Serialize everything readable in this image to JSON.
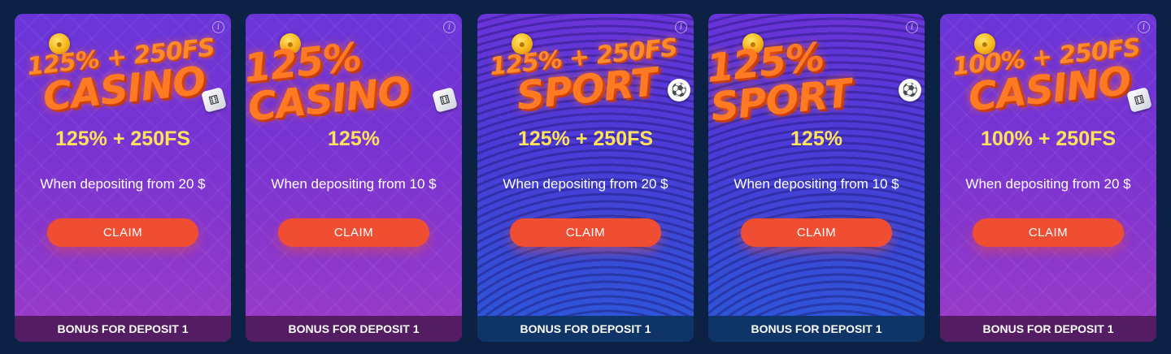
{
  "cards": [
    {
      "theme": "casino",
      "banner_line1": "125% + 250FS",
      "banner_line2": "CASINO",
      "amount": "125% + 250FS",
      "condition": "When depositing from 20 $",
      "claim_label": "CLAIM",
      "footer": "BONUS FOR DEPOSIT 1"
    },
    {
      "theme": "casino",
      "banner_line1": "",
      "banner_line2": "125% CASINO",
      "amount": "125%",
      "condition": "When depositing from 10 $",
      "claim_label": "CLAIM",
      "footer": "BONUS FOR DEPOSIT 1"
    },
    {
      "theme": "sport",
      "banner_line1": "125% + 250FS",
      "banner_line2": "SPORT",
      "amount": "125% + 250FS",
      "condition": "When depositing from 20 $",
      "claim_label": "CLAIM",
      "footer": "BONUS FOR DEPOSIT 1"
    },
    {
      "theme": "sport",
      "banner_line1": "",
      "banner_line2": "125% SPORT",
      "amount": "125%",
      "condition": "When depositing from 10 $",
      "claim_label": "CLAIM",
      "footer": "BONUS FOR DEPOSIT 1"
    },
    {
      "theme": "casino",
      "banner_line1": "100% + 250FS",
      "banner_line2": "CASINO",
      "amount": "100% + 250FS",
      "condition": "When depositing from 20 $",
      "claim_label": "CLAIM",
      "footer": "BONUS FOR DEPOSIT 1"
    }
  ],
  "icons": {
    "info": "info-icon",
    "coin": "coin-icon",
    "dice": "dice-icon",
    "ball": "soccer-ball-icon"
  },
  "colors": {
    "page_bg": "#0b2244",
    "amount_text": "#ffe25a",
    "claim_button": "#f04e32",
    "casino_footer": "#541c63",
    "sport_footer": "#0e3468"
  }
}
